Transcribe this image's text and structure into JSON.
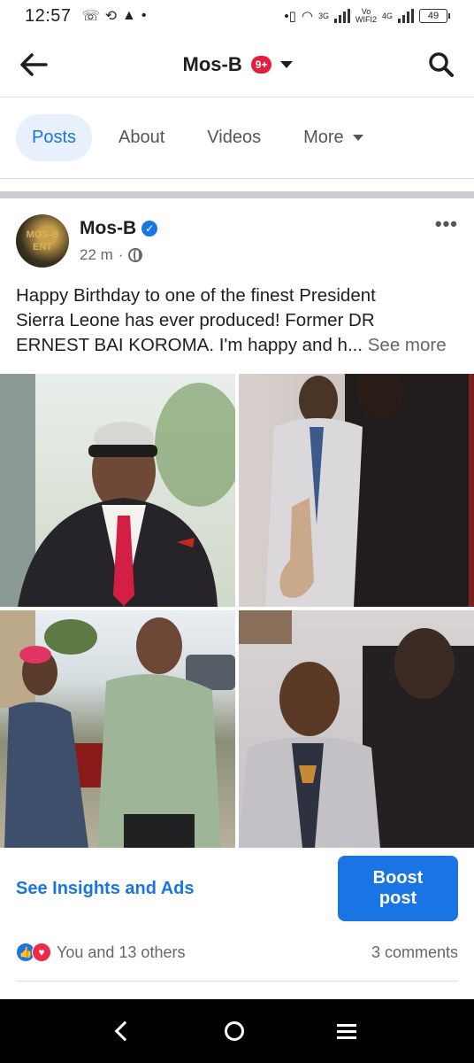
{
  "status_bar": {
    "time": "12:57",
    "net_vo": "Vo",
    "net_wifi": "WIFI2",
    "net_3g": "3G",
    "net_4g": "4G",
    "battery": "49"
  },
  "header": {
    "title": "Mos-B",
    "notif_badge": "9+"
  },
  "tabs": [
    {
      "label": "Posts",
      "active": true
    },
    {
      "label": "About",
      "active": false
    },
    {
      "label": "Videos",
      "active": false
    },
    {
      "label": "More",
      "active": false
    }
  ],
  "post": {
    "author": "Mos-B",
    "avatar_text": "MOS-B ENT",
    "time": "22 m",
    "text_line1": "Happy Birthday to one of the finest President",
    "text_line2": "Sierra Leone has ever produced! Former DR",
    "text_line3": "ERNEST BAI KOROMA. I'm happy and h...",
    "see_more": "See more",
    "insights_label": "See Insights and Ads",
    "boost_label": "Boost post",
    "reactions_text": "You and 13 others",
    "comments_text": "3 comments"
  },
  "colors": {
    "accent": "#1b74e4",
    "badge_red": "#e41e3f",
    "love_red": "#f0284a"
  }
}
